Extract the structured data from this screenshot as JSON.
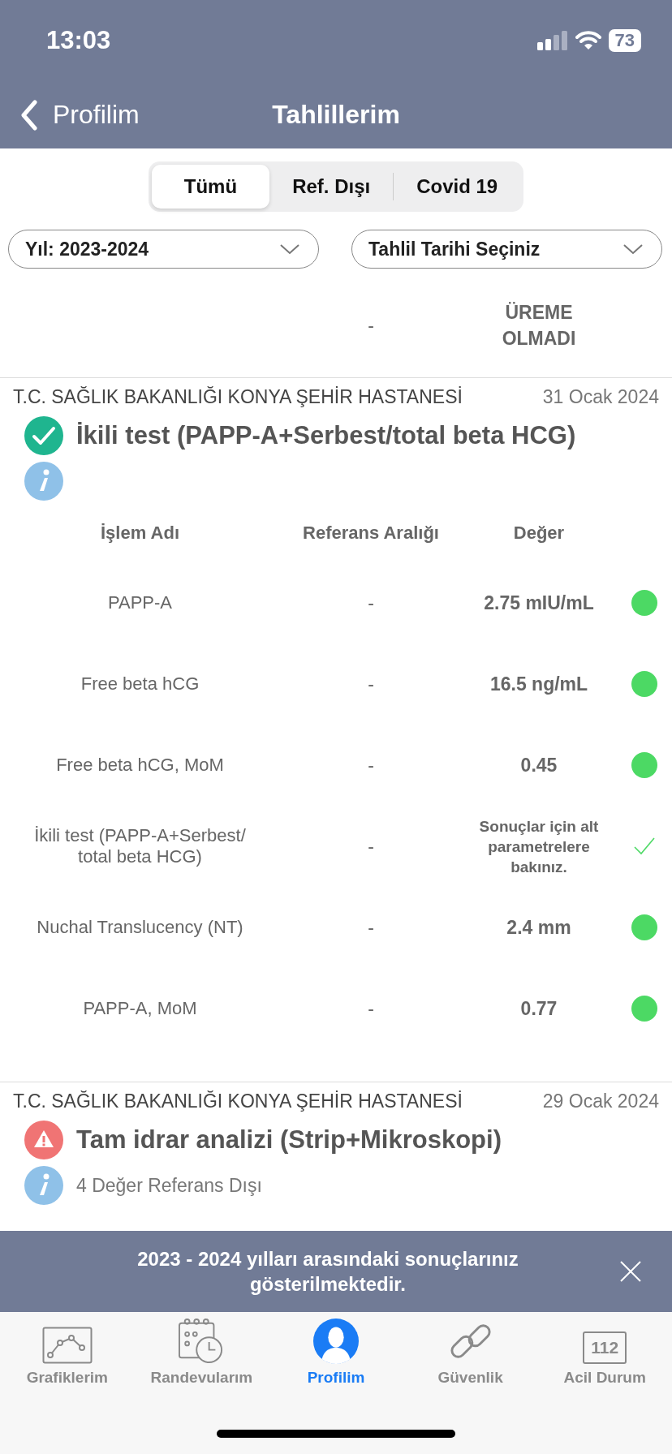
{
  "status_bar": {
    "time": "13:03",
    "battery": "73"
  },
  "nav": {
    "back_label": "Profilim",
    "title": "Tahlillerim"
  },
  "tabs": [
    {
      "label": "Tümü",
      "selected": true
    },
    {
      "label": "Ref. Dışı",
      "selected": false
    },
    {
      "label": "Covid 19",
      "selected": false
    }
  ],
  "filters": [
    {
      "value": "Yıl: 2023-2024"
    },
    {
      "value": "Tahlil Tarihi Seçiniz"
    }
  ],
  "partial_row": {
    "reference": "-",
    "value": "ÜREME OLMADI"
  },
  "cards": [
    {
      "hospital": "T.C. SAĞLIK BAKANLIĞI KONYA ŞEHİR HASTANESİ",
      "date": "31 Ocak 2024",
      "kind": "ok",
      "title": "İkili test (PAPP-A+Serbest/total beta HCG)",
      "columns": [
        "İşlem Adı",
        "Referans Aralığı",
        "Değer"
      ],
      "rows": [
        {
          "name": "PAPP-A",
          "reference": "-",
          "value": "2.75 mIU/mL",
          "kind": "dot",
          "color": "#4cd964"
        },
        {
          "name": "Free beta hCG",
          "reference": "-",
          "value": "16.5 ng/mL",
          "kind": "dot",
          "color": "#4cd964"
        },
        {
          "name": "Free beta hCG, MoM",
          "reference": "-",
          "value": "0.45",
          "kind": "dot",
          "color": "#4cd964"
        },
        {
          "name": "İkili test (PAPP-A+Serbest/ total beta HCG)",
          "reference": "-",
          "value": "Sonuçlar için alt parametrelere bakınız.",
          "kind": "check"
        },
        {
          "name": "Nuchal Translucency (NT)",
          "reference": "-",
          "value": "2.4 mm",
          "kind": "dot",
          "color": "#4cd964"
        },
        {
          "name": "PAPP-A, MoM",
          "reference": "-",
          "value": "0.77",
          "kind": "dot",
          "color": "#4cd964"
        }
      ]
    },
    {
      "hospital": "T.C. SAĞLIK BAKANLIĞI KONYA ŞEHİR HASTANESİ",
      "date": "29 Ocak 2024",
      "kind": "warning",
      "title": "Tam idrar analizi (Strip+Mikroskopi)",
      "info": "4 Değer Referans Dışı"
    }
  ],
  "banner": {
    "message": "2023 - 2024 yılları arasındaki sonuçlarınız gösterilmektedir."
  },
  "tab_bar": [
    {
      "label": "Grafiklerim",
      "kind": "chart",
      "selected": false
    },
    {
      "label": "Randevularım",
      "kind": "calendar",
      "selected": false
    },
    {
      "label": "Profilim",
      "kind": "profile",
      "selected": true
    },
    {
      "label": "Güvenlik",
      "kind": "link",
      "selected": false
    },
    {
      "label": "Acil Durum",
      "kind": "emergency",
      "icon_text": "112",
      "selected": false
    }
  ]
}
